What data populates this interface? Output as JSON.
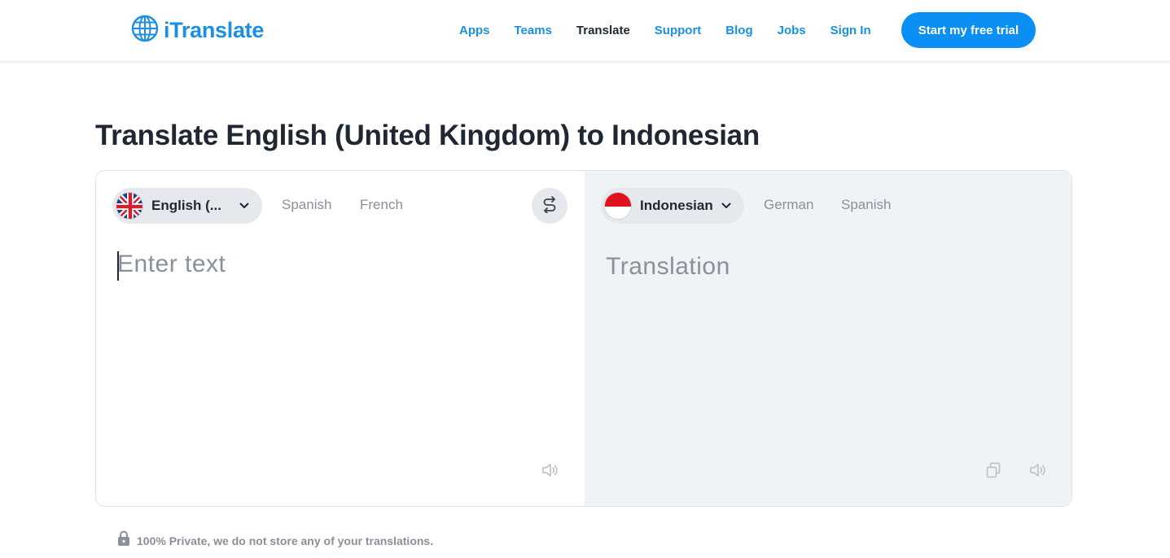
{
  "brand": {
    "name": "iTranslate",
    "color": "#1a8fe3"
  },
  "nav": {
    "items": [
      {
        "label": "Apps",
        "active": false
      },
      {
        "label": "Teams",
        "active": false
      },
      {
        "label": "Translate",
        "active": true
      },
      {
        "label": "Support",
        "active": false
      },
      {
        "label": "Blog",
        "active": false
      },
      {
        "label": "Jobs",
        "active": false
      },
      {
        "label": "Sign In",
        "active": false
      }
    ],
    "cta_label": "Start my free trial"
  },
  "page": {
    "title": "Translate English (United Kingdom) to Indonesian"
  },
  "source": {
    "selected_language": "English (...",
    "flag": "uk-flag-icon",
    "quick_languages": [
      "Spanish",
      "French"
    ],
    "placeholder": "Enter text",
    "value": ""
  },
  "target": {
    "selected_language": "Indonesian",
    "flag": "indonesia-flag-icon",
    "quick_languages": [
      "German",
      "Spanish"
    ],
    "placeholder": "Translation"
  },
  "icons": {
    "swap": "swap-languages-icon",
    "speaker": "speaker-icon",
    "copy": "copy-icon",
    "lock": "lock-icon",
    "chevron": "chevron-down-icon",
    "globe": "globe-icon"
  },
  "privacy": {
    "text": "100% Private, we do not store any of your translations."
  },
  "colors": {
    "accent": "#0a8ff5",
    "target_bg": "#f0f3f6",
    "muted_text": "#8a9099"
  }
}
